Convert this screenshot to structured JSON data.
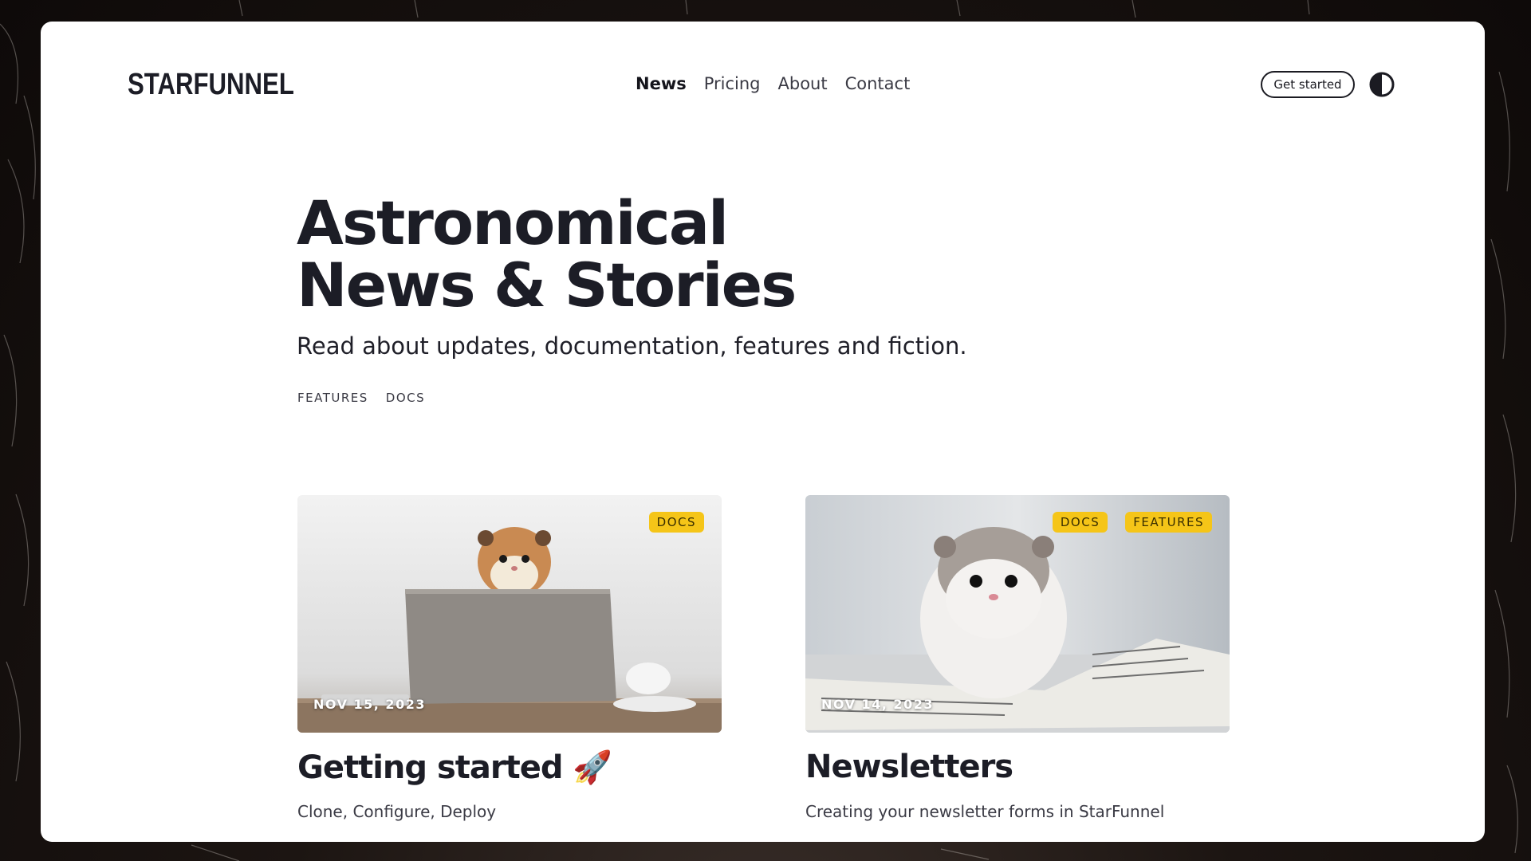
{
  "site": {
    "logo": "STARFUNNEL"
  },
  "nav": [
    {
      "label": "News",
      "active": true
    },
    {
      "label": "Pricing",
      "active": false
    },
    {
      "label": "About",
      "active": false
    },
    {
      "label": "Contact",
      "active": false
    }
  ],
  "header": {
    "cta_label": "Get started",
    "theme_toggle_icon": "contrast-icon"
  },
  "hero": {
    "title_line1": "Astronomical",
    "title_line2": "News & Stories",
    "subtitle": "Read about updates, documentation, features and fiction."
  },
  "tags": [
    "FEATURES",
    "DOCS"
  ],
  "posts": [
    {
      "title": "Getting started",
      "emoji": "🚀",
      "description": "Clone, Configure, Deploy",
      "date": "NOV 15, 2023",
      "badges": [
        "DOCS"
      ],
      "image": "hamster-with-laptop"
    },
    {
      "title": "Newsletters",
      "description": "Creating your newsletter forms in StarFunnel",
      "date": "NOV 14, 2023",
      "badges": [
        "DOCS",
        "FEATURES"
      ],
      "image": "hamster-on-newspaper"
    }
  ],
  "colors": {
    "badge": "#f5c518",
    "text": "#1c1d26",
    "background": "#ffffff"
  }
}
